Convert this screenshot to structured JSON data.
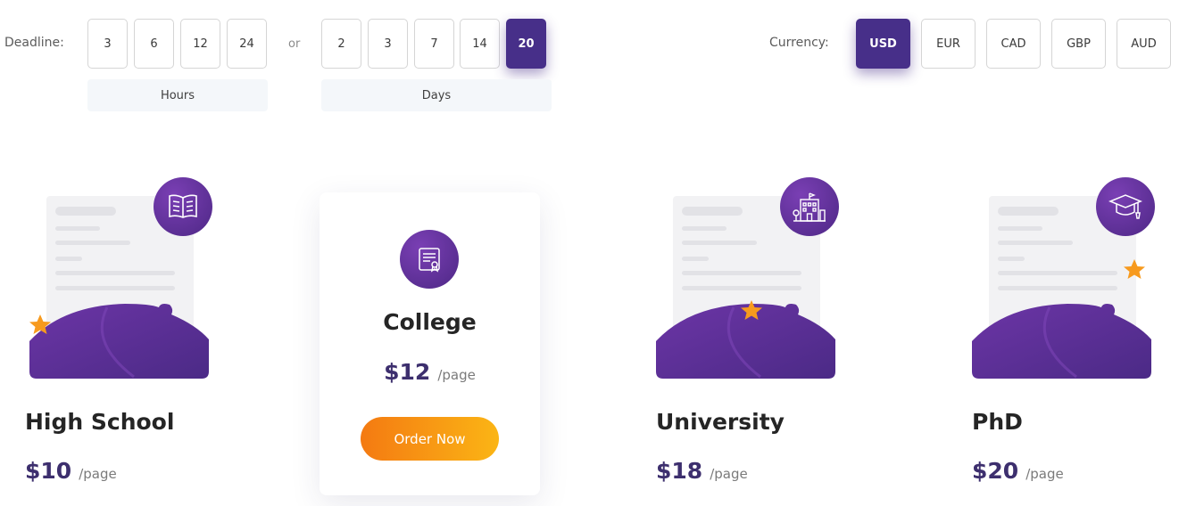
{
  "deadline": {
    "label": "Deadline:",
    "or_text": "or",
    "hours": {
      "label": "Hours",
      "options": [
        "3",
        "6",
        "12",
        "24"
      ]
    },
    "days": {
      "label": "Days",
      "options": [
        "2",
        "3",
        "7",
        "14",
        "20"
      ],
      "selected": "20"
    }
  },
  "currency": {
    "label": "Currency:",
    "options": [
      "USD",
      "EUR",
      "CAD",
      "GBP",
      "AUD"
    ],
    "selected": "USD"
  },
  "plans": [
    {
      "title": "High School",
      "price": "$10",
      "per": "/page",
      "icon": "open-book-icon"
    },
    {
      "title": "College",
      "price": "$12",
      "per": "/page",
      "icon": "diploma-certificate-icon",
      "cta": "Order Now"
    },
    {
      "title": "University",
      "price": "$18",
      "per": "/page",
      "icon": "university-building-icon"
    },
    {
      "title": "PhD",
      "price": "$20",
      "per": "/page",
      "icon": "graduation-cap-icon"
    }
  ],
  "colors": {
    "accent": "#472f89",
    "purple": "#5d2f98",
    "orange": "#f5831a",
    "star": "#f79a1e"
  }
}
